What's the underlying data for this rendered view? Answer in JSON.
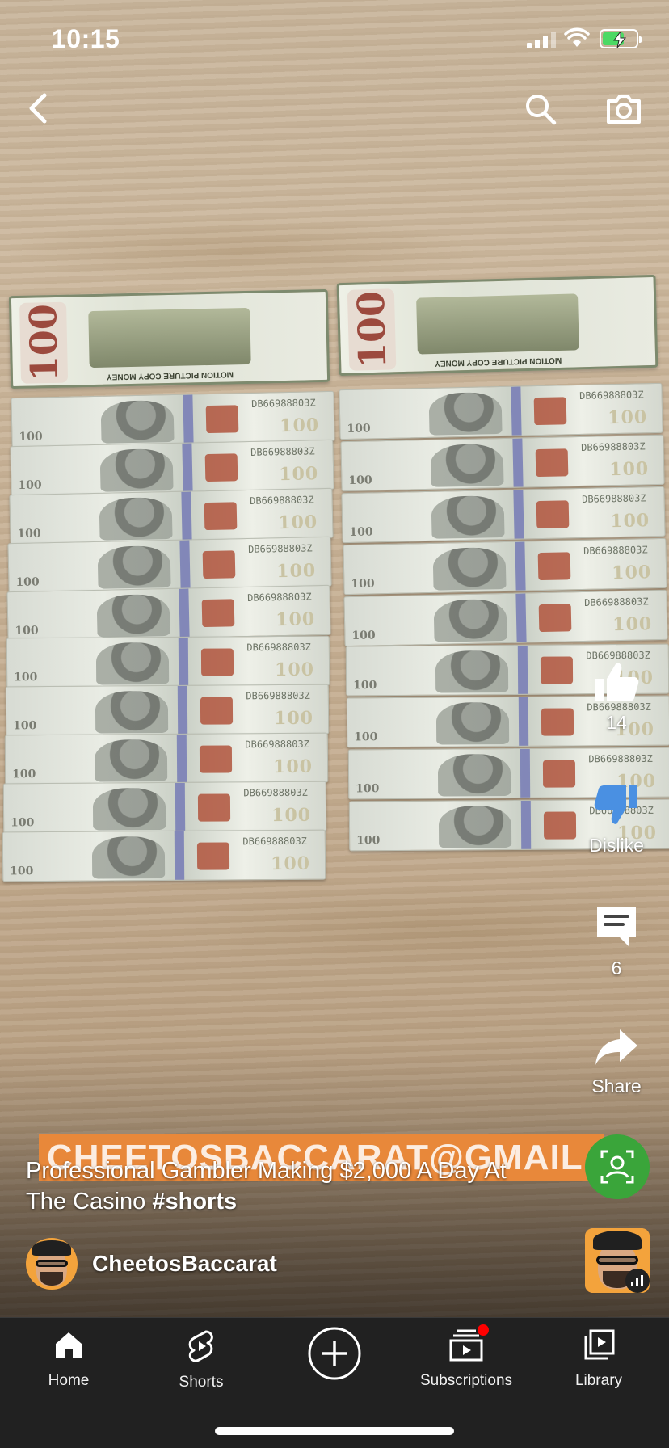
{
  "status_bar": {
    "time": "10:15",
    "battery_color": "#4cd964"
  },
  "top_bar": {
    "back_icon": "chevron-left-icon",
    "search_icon": "search-icon",
    "camera_icon": "camera-icon"
  },
  "bill_text": {
    "front_value": "100",
    "back_value": "100",
    "serial": "DB66988803Z",
    "back_caption": "MOTION PICTURE COPY MONEY"
  },
  "actions": {
    "like": {
      "count": "14"
    },
    "dislike": {
      "label": "Dislike"
    },
    "comments": {
      "count": "6"
    },
    "share": {
      "label": "Share"
    }
  },
  "overlay": {
    "banner_text": "CHEETOSBACCARAT@GMAIL.CO",
    "banner_color": "#e8883a"
  },
  "video": {
    "title_text": "Professional Gambler Making $2,000 A Day At The Casino ",
    "title_hashtag": "#shorts",
    "channel_name": "CheetosBaccarat"
  },
  "nav": {
    "items": [
      {
        "label": "Home",
        "icon": "home-icon"
      },
      {
        "label": "Shorts",
        "icon": "shorts-icon"
      },
      {
        "label": "",
        "icon": "create-plus-icon"
      },
      {
        "label": "Subscriptions",
        "icon": "subscriptions-icon"
      },
      {
        "label": "Library",
        "icon": "library-icon"
      }
    ]
  },
  "colors": {
    "nav_bg": "#212121",
    "notification_dot": "#ff0000",
    "green_badge": "#3aa53a",
    "avatar_bg": "#f3a33c"
  }
}
